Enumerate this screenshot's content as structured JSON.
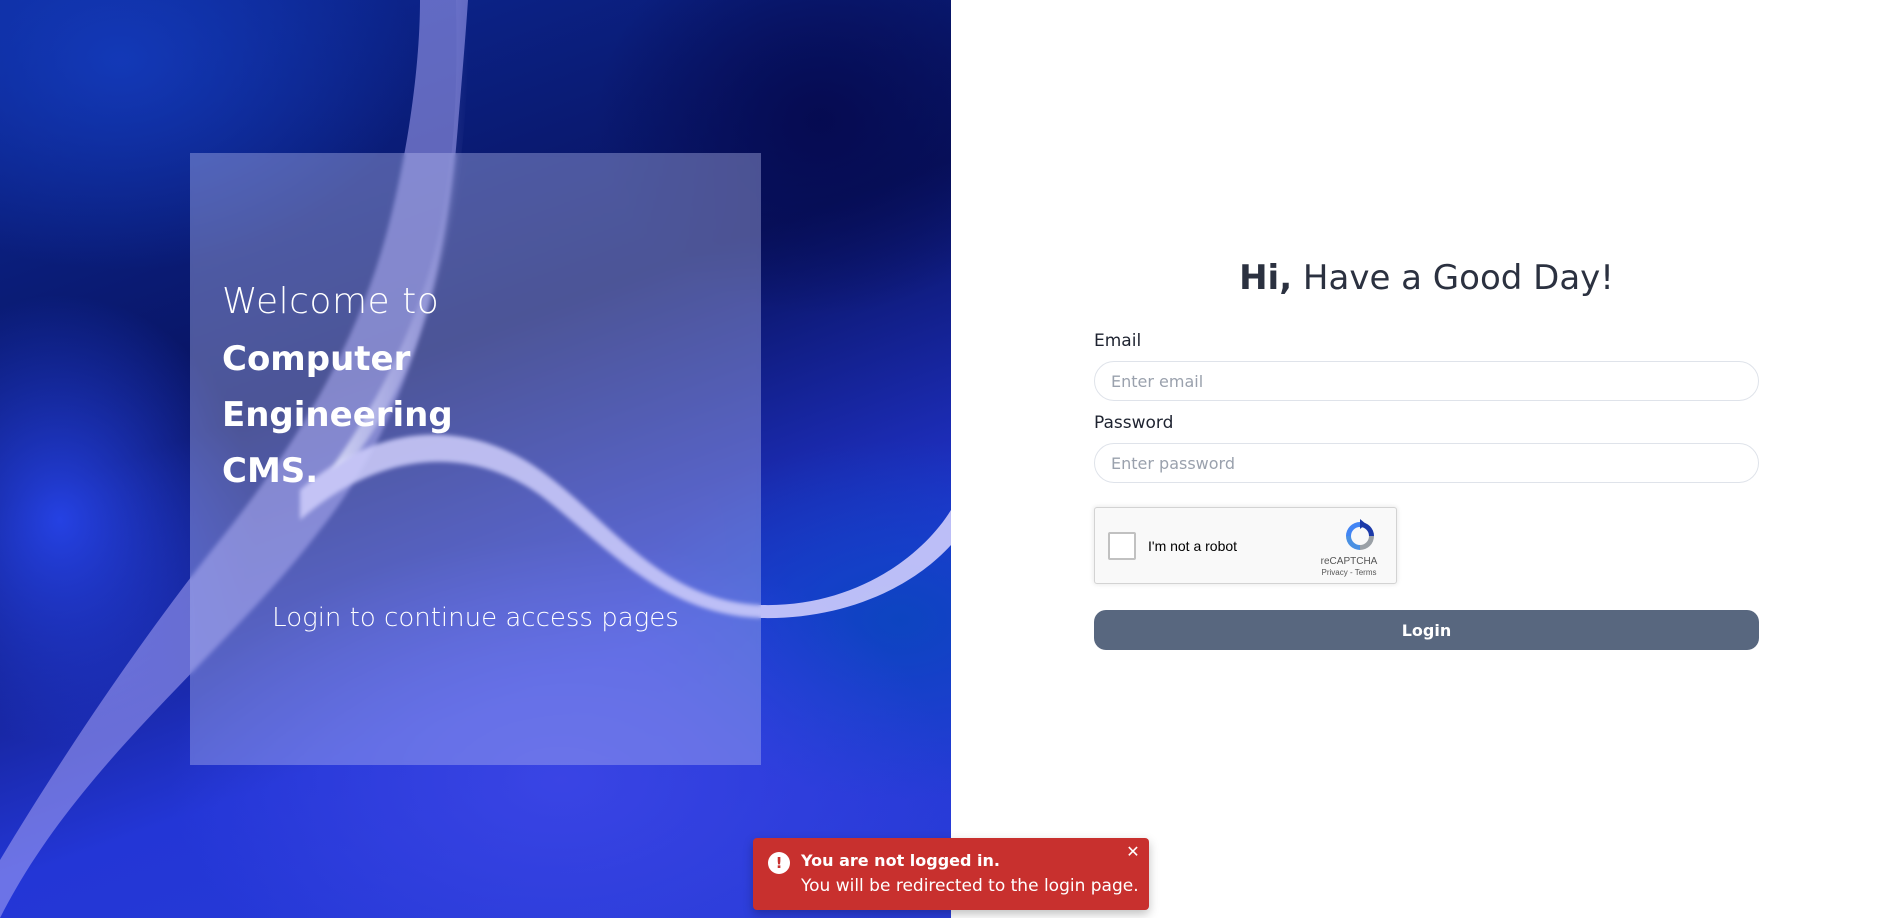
{
  "hero": {
    "welcome": "Welcome to",
    "brand_line_1": "Computer",
    "brand_line_2": "Engineering",
    "brand_line_3": "CMS.",
    "subtitle": "Login to continue access pages"
  },
  "login_form": {
    "greeting_bold": "Hi,",
    "greeting_rest": " Have a Good Day!",
    "email_label": "Email",
    "email_placeholder": "Enter email",
    "email_value": "",
    "password_label": "Password",
    "password_placeholder": "Enter password",
    "password_value": "",
    "submit_label": "Login"
  },
  "recaptcha": {
    "label": "I'm not a robot",
    "brand": "reCAPTCHA",
    "privacy_link": "Privacy",
    "separator": " - ",
    "terms_link": "Terms",
    "checked": false
  },
  "toast": {
    "title": "You are not logged in.",
    "message": "You will be redirected to the login page.",
    "icon": "alert-circle-icon",
    "close_icon": "close-icon",
    "color": "#c8302e"
  },
  "colors": {
    "login_button": "#58677f",
    "heading_text": "#2b3140",
    "toast_background": "#c8302e"
  }
}
